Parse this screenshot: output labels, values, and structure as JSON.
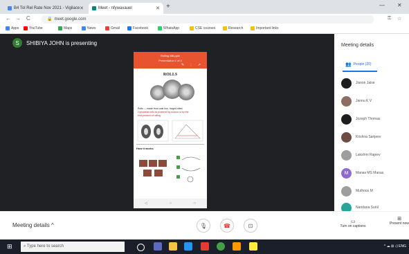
{
  "browser": {
    "tabs": [
      {
        "title": "B4 Tol Rel Rate Nov 2021 - Vigilace",
        "active": false,
        "fav_color": "#4285f4"
      },
      {
        "title": "Meet - nfywaxauel",
        "active": true,
        "fav_color": "#00897b"
      }
    ],
    "new_tab": "+",
    "minimize": "—",
    "close": "✕",
    "back": "←",
    "forward": "→",
    "reload": "C",
    "url": "meet.google.com",
    "bookmarks": [
      {
        "label": "Apps",
        "color": "#4285f4"
      },
      {
        "label": "YouTube",
        "color": "#ff0000"
      },
      {
        "label": "Maps",
        "color": "#34a853"
      },
      {
        "label": "News",
        "color": "#4285f4"
      },
      {
        "label": "Gmail",
        "color": "#ea4335"
      },
      {
        "label": "Facebook",
        "color": "#1877f2"
      },
      {
        "label": "WhatsApp",
        "color": "#25d366"
      },
      {
        "label": "CSE courses",
        "color": "#f4c20d"
      },
      {
        "label": "Research",
        "color": "#f4c20d"
      },
      {
        "label": "Important links",
        "color": "#f4c20d"
      }
    ]
  },
  "meet": {
    "presenter_initial": "S",
    "presenter_text": "SHIBIYA JOHN is presenting",
    "slide": {
      "header_line1": "Rolling Mill.pptx",
      "header_line2": "Presentation 1 of 4",
      "tools": "✎ ⋮ ↗",
      "title": "ROLLS",
      "text_line1": "Rolls — made from cast iron, forged steel,",
      "text_line2": "Cylindrical rolls as powered by motors or by the",
      "text_line3": "end-product of rolling",
      "section_heading": "How it works",
      "nav": [
        "◁",
        "○",
        "□"
      ]
    },
    "panel_title": "Meeting details",
    "people_tab": "People (20)",
    "participants": [
      {
        "name": "Jisnon Jaise",
        "color": "#1d1d1d",
        "initial": ""
      },
      {
        "name": "Jannu K V",
        "color": "#8d6e63",
        "initial": ""
      },
      {
        "name": "Jozeph Thomas",
        "color": "#1d1d1d",
        "initial": ""
      },
      {
        "name": "Krishna Sanjeev",
        "color": "#6d4c41",
        "initial": ""
      },
      {
        "name": "Lakshmi Rajeev",
        "color": "#9e9e9e",
        "initial": ""
      },
      {
        "name": "Manas MS Manas",
        "color": "#8e6ad1",
        "initial": "M"
      },
      {
        "name": "Muthoos M",
        "color": "#9e9e9e",
        "initial": ""
      },
      {
        "name": "Nandana Sunil",
        "color": "#26a69a",
        "initial": ""
      }
    ],
    "bottom": {
      "meeting_details": "Meeting details",
      "chevron": "^",
      "mic_icon": "🎙",
      "end_icon": "☎",
      "present_icon": "⊡",
      "captions": "Turn on captions",
      "present_now": "Present now"
    }
  },
  "taskbar": {
    "search_placeholder": "Type here to search",
    "tray_text": "^ ☁ ⊞ ♪) ENG",
    "icons": [
      "#ffffff",
      "#f5c542",
      "#2196f3",
      "#e53935",
      "#43a047",
      "#ff9800",
      "#ffeb3b"
    ]
  }
}
